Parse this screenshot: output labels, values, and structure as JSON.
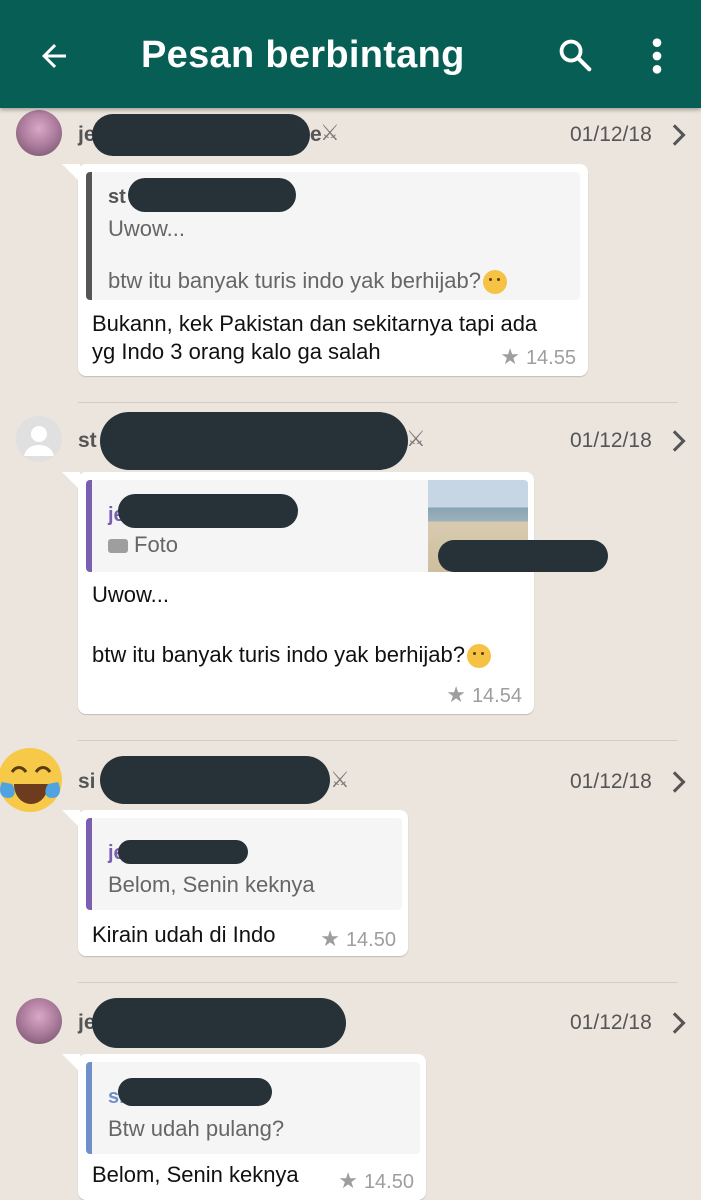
{
  "appbar": {
    "title": "Pesan berbintang",
    "color": "#075e54"
  },
  "entries": [
    {
      "sender_prefix": "je",
      "sender_suffix": "e",
      "date": "01/12/18",
      "quote_name": "st",
      "quote_lines": [
        "Uwow...",
        "btw itu banyak turis indo yak berhijab?"
      ],
      "message_lines": [
        "Bukann, kek Pakistan dan sekitarnya tapi ada",
        "yg Indo 3 orang kalo ga salah"
      ],
      "time": "14.55"
    },
    {
      "sender_prefix": "st",
      "date": "01/12/18",
      "quote_name": "je",
      "quote_lines": [
        "Foto"
      ],
      "message_lines": [
        "Uwow...",
        "btw itu banyak turis indo yak berhijab?"
      ],
      "time": "14.54"
    },
    {
      "sender_prefix": "si",
      "date": "01/12/18",
      "quote_name": "je",
      "quote_lines": [
        "Belom, Senin keknya"
      ],
      "message_lines": [
        "Kirain udah di Indo"
      ],
      "time": "14.50"
    },
    {
      "sender_prefix": "je",
      "date": "01/12/18",
      "quote_name": "si",
      "quote_lines": [
        "Btw udah pulang?"
      ],
      "message_lines": [
        "Belom, Senin keknya"
      ],
      "time": "14.50"
    }
  ]
}
